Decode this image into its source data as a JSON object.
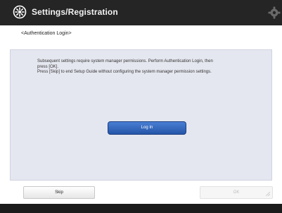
{
  "titlebar": {
    "title": "Settings/Registration",
    "icon": "settings-registration-icon",
    "right_icon": "gear-icon"
  },
  "breadcrumb": "<Authentication Login>",
  "message": {
    "lines": [
      "Subsequent settings require system manager permissions. Perform Authentication Login, then",
      "press [OK].",
      "Press [Skip] to end Setup Guide without configuring the system manager permission settings."
    ]
  },
  "buttons": {
    "login": "Log In",
    "skip": "Skip",
    "ok": "OK"
  },
  "colors": {
    "titlebar": "#252525",
    "panel": "#e5e7f0",
    "accent_button": "#2f62b8"
  }
}
